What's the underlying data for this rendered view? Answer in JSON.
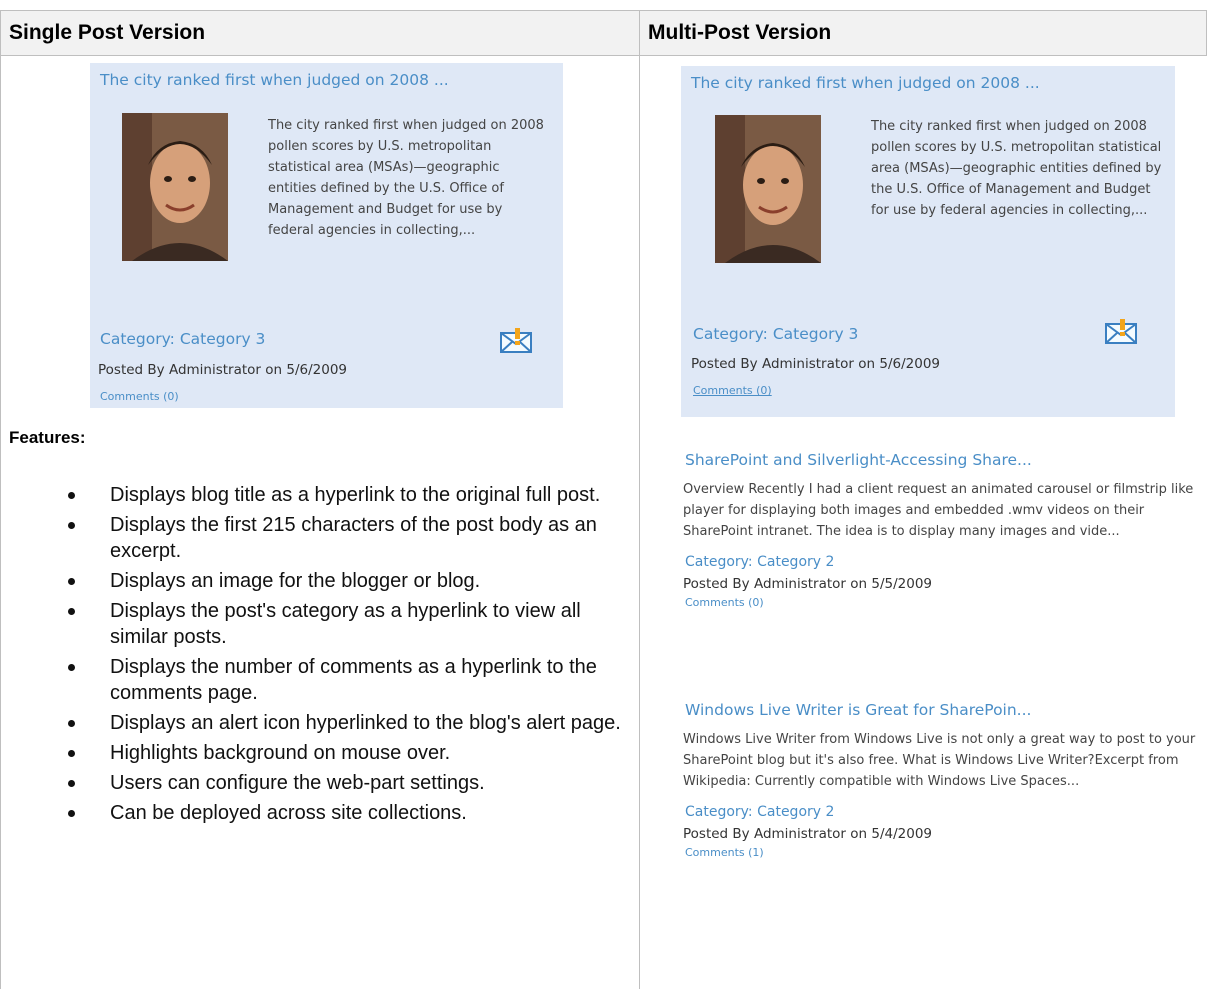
{
  "headers": {
    "single": "Single Post Version",
    "multi": "Multi-Post Version"
  },
  "featured_post": {
    "title": "The city ranked first when judged on 2008 ...",
    "excerpt": "The city ranked first when judged on 2008 pollen scores by U.S. metropolitan statistical area (MSAs)—geographic entities defined by the U.S. Office of Management and Budget for use by federal agencies in collecting,...",
    "category": "Category: Category 3",
    "posted": "Posted By Administrator on  5/6/2009",
    "comments": "Comments (0)"
  },
  "features_label": "Features:",
  "features": [
    "Displays blog title as a hyperlink to the original full post.",
    "Displays the first 215 characters of the post body as an excerpt.",
    "Displays an image for the blogger or blog.",
    "Displays the post's category as a hyperlink to view all similar posts.",
    "Displays the number of comments as a hyperlink to the comments page.",
    "Displays an alert icon hyperlinked to the blog's alert page.",
    "Highlights background on mouse over.",
    "Users can configure the web-part settings.",
    "Can be deployed across site collections."
  ],
  "posts": [
    {
      "title": "SharePoint and Silverlight-Accessing Share...",
      "excerpt": "Overview   Recently I had a client request an animated carousel or filmstrip like player for displaying both images and embedded .wmv videos on their SharePoint intranet.  The idea is to display many images and vide...",
      "category": "Category: Category 2",
      "posted": "Posted By Administrator on  5/5/2009",
      "comments": "Comments (0)"
    },
    {
      "title": "Windows Live Writer is Great for SharePoin...",
      "excerpt": "Windows Live Writer from Windows Live is not only a great way to post to your SharePoint blog but it's also free.    What is Windows Live Writer?Excerpt from Wikipedia:  Currently compatible with Windows Live Spaces...",
      "category": "Category: Category 2",
      "posted": "Posted By Administrator on  5/4/2009",
      "comments": "Comments (1)"
    }
  ],
  "colors": {
    "card_bg": "#dfe8f6",
    "link": "#4a8ec7",
    "header_bg": "#f2f2f2"
  }
}
